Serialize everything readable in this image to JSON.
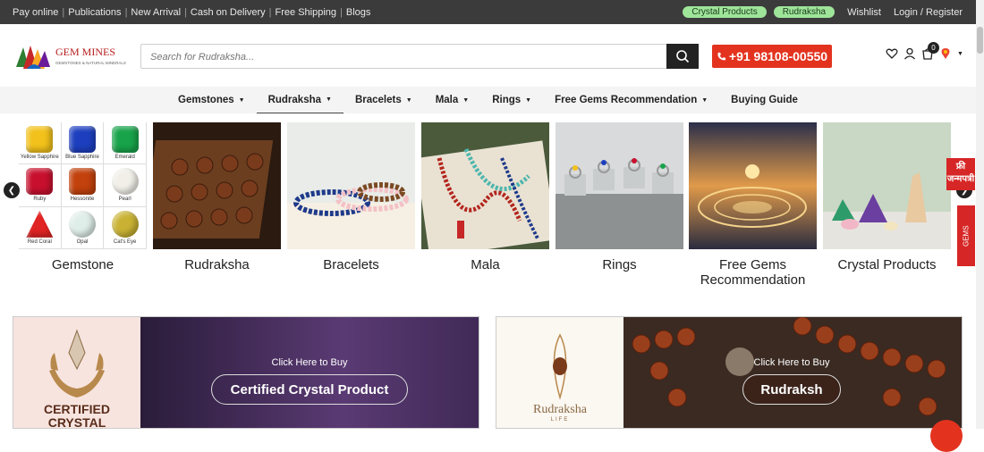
{
  "topbar": {
    "links": [
      "Pay online",
      "Publications",
      "New Arrival",
      "Cash on Delivery",
      "Free Shipping",
      "Blogs"
    ],
    "pill_crystal": "Crystal Products",
    "pill_rudraksha": "Rudraksha",
    "wishlist": "Wishlist",
    "login": "Login / Register"
  },
  "header": {
    "logo_text": "GEM MINES",
    "logo_tagline": "GEMSTONES & NATURAL MINERALS",
    "search_placeholder": "Search for Rudraksha...",
    "phone": "+91 98108-00550",
    "cart_count": "0"
  },
  "nav": {
    "items": [
      {
        "label": "Gemstones",
        "caret": true
      },
      {
        "label": "Rudraksha",
        "caret": true
      },
      {
        "label": "Bracelets",
        "caret": true
      },
      {
        "label": "Mala",
        "caret": true
      },
      {
        "label": "Rings",
        "caret": true
      },
      {
        "label": "Free Gems Recommendation",
        "caret": true
      },
      {
        "label": "Buying Guide",
        "caret": false
      }
    ]
  },
  "categories": [
    {
      "label": "Gemstone"
    },
    {
      "label": "Rudraksha"
    },
    {
      "label": "Bracelets"
    },
    {
      "label": "Mala"
    },
    {
      "label": "Rings"
    },
    {
      "label": "Free Gems Recommendation"
    },
    {
      "label": "Crystal Products"
    }
  ],
  "gem_grid": [
    {
      "name": "Yellow Sapphire",
      "color": "#f2c11b"
    },
    {
      "name": "Blue Sapphire",
      "color": "#1d3fbf"
    },
    {
      "name": "Emerald",
      "color": "#18a34a"
    },
    {
      "name": "Ruby",
      "color": "#c8102e"
    },
    {
      "name": "Hessonite",
      "color": "#c2410c"
    },
    {
      "name": "Pearl",
      "color": "#f1efe8"
    },
    {
      "name": "Red Coral",
      "color": "#e02424"
    },
    {
      "name": "Opal",
      "color": "#dfeee9"
    },
    {
      "name": "Cat's Eye",
      "color": "#c9b233"
    }
  ],
  "banners": {
    "crystal": {
      "top_text": "Click Here to Buy",
      "cta": "Certified Crystal Product",
      "left_title": "CERTIFIED CRYSTAL"
    },
    "rudraksha": {
      "top_text": "Click Here to Buy",
      "cta": "Rudraksh",
      "left_title": "Rudraksha",
      "left_sub": "LIFE"
    }
  },
  "side_tabs": {
    "kundli": "फ्री जन्मपत्री",
    "gems": "GEMS"
  },
  "colors": {
    "accent_red": "#e3331f",
    "topbar_bg": "#3b3b3b",
    "pill_green": "#9ee59a"
  }
}
